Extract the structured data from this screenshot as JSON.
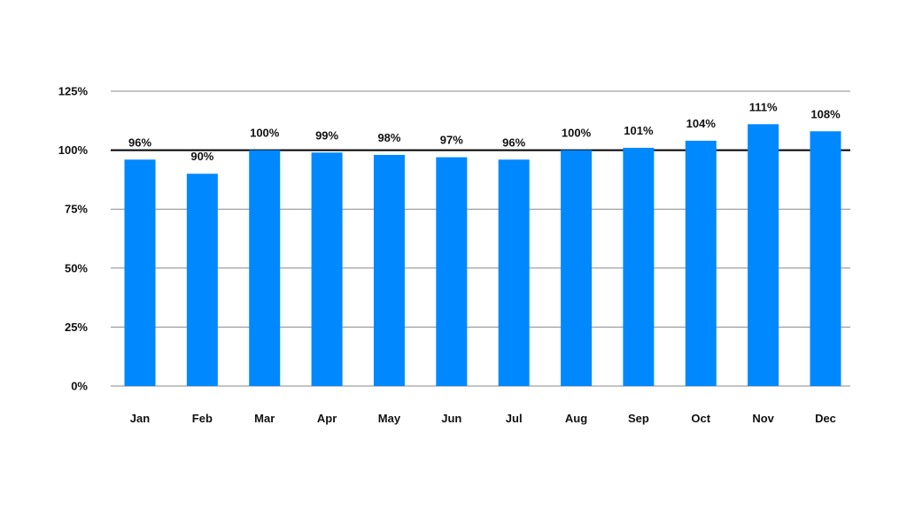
{
  "chart_data": {
    "type": "bar",
    "title": "",
    "xlabel": "",
    "ylabel": "",
    "categories": [
      "Jan",
      "Feb",
      "Mar",
      "Apr",
      "May",
      "Jun",
      "Jul",
      "Aug",
      "Sep",
      "Oct",
      "Nov",
      "Dec"
    ],
    "values": [
      96,
      90,
      100,
      99,
      98,
      97,
      96,
      100,
      101,
      104,
      111,
      108
    ],
    "data_labels": [
      "96%",
      "90%",
      "100%",
      "99%",
      "98%",
      "97%",
      "96%",
      "100%",
      "101%",
      "104%",
      "111%",
      "108%"
    ],
    "ylim": [
      0,
      125
    ],
    "yticks": [
      0,
      25,
      50,
      75,
      100,
      125
    ],
    "ytick_labels": [
      "0%",
      "25%",
      "50%",
      "75%",
      "100%",
      "125%"
    ],
    "reference_line": {
      "value": 100,
      "color": "#000000"
    },
    "grid": true,
    "legend": "none",
    "colors": {
      "bar": "#0088FF",
      "grid": "#888888",
      "text": "#111111"
    }
  }
}
